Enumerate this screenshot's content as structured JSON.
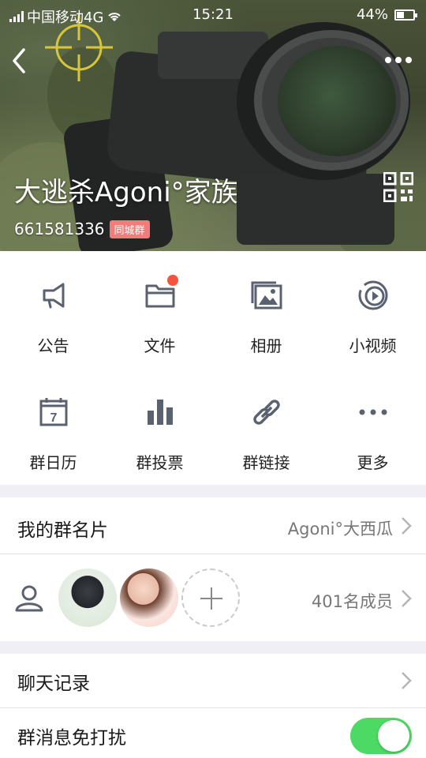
{
  "status_bar": {
    "carrier": "中国移动4G",
    "time": "15:21",
    "battery": "44%",
    "battery_level": 0.44
  },
  "header": {
    "group_name": "大逃杀Agoni°家族",
    "group_id": "661581336",
    "city_badge": "同城群"
  },
  "grid": [
    {
      "label": "公告",
      "icon": "megaphone-icon"
    },
    {
      "label": "文件",
      "icon": "folder-icon",
      "badge_dot": true
    },
    {
      "label": "相册",
      "icon": "photo-album-icon"
    },
    {
      "label": "小视频",
      "icon": "video-icon"
    },
    {
      "label": "群日历",
      "icon": "calendar-icon",
      "calendar_day": "7"
    },
    {
      "label": "群投票",
      "icon": "bar-chart-icon"
    },
    {
      "label": "群链接",
      "icon": "link-icon"
    },
    {
      "label": "更多",
      "icon": "more-dots-icon"
    }
  ],
  "card_row": {
    "label": "我的群名片",
    "value": "Agoni°大西瓜"
  },
  "members_row": {
    "count_text": "401名成员"
  },
  "chat_history": {
    "label": "聊天记录"
  },
  "mute_row": {
    "label": "群消息免打扰",
    "enabled": true
  },
  "colors": {
    "toggle_on": "#4cd964",
    "badge_red": "#f5533d",
    "city_badge": "#f07c7c",
    "icon_gray": "#5a6270"
  }
}
